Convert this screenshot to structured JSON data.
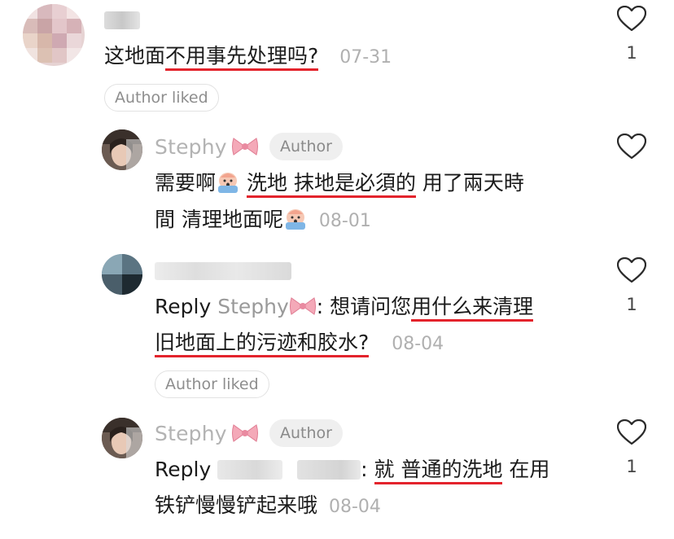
{
  "comments": [
    {
      "text_before": "这地面",
      "text_underlined": "不用事先处理吗?",
      "date": "07-31",
      "like_count": "1",
      "author_liked": "Author liked"
    },
    {
      "username": "Stephy",
      "badge": "Author",
      "text_line1_a": "需要啊",
      "text_line1_underlined": "洗地 抹地是必須的",
      "text_line1_b": " 用了兩天時",
      "text_line2": "間 清理地面呢",
      "date": "08-01"
    },
    {
      "reply_prefix": "Reply",
      "reply_to": "Stephy",
      "text_line1_a": ": 想请问您",
      "text_line1_underlined": "用什么来清理",
      "text_line2_underlined": "旧地面上的污迹和胶水?",
      "date": "08-04",
      "like_count": "1",
      "author_liked": "Author liked"
    },
    {
      "username": "Stephy",
      "badge": "Author",
      "reply_prefix": "Reply",
      "text_line1_a": ": ",
      "text_line1_underlined": "就 普通的洗地",
      "text_line1_b": " 在用",
      "text_line2": "铁铲慢慢铲起来哦",
      "date": "08-04",
      "like_count": "1"
    }
  ],
  "icons": {
    "heart": "heart-outline-icon",
    "emoji": "scared-face-emoji",
    "bow": "pink-bow-emoji"
  },
  "colors": {
    "underline": "#e3232c",
    "muted_text": "#b0b0b0",
    "pill_border": "#e2e2e2"
  }
}
